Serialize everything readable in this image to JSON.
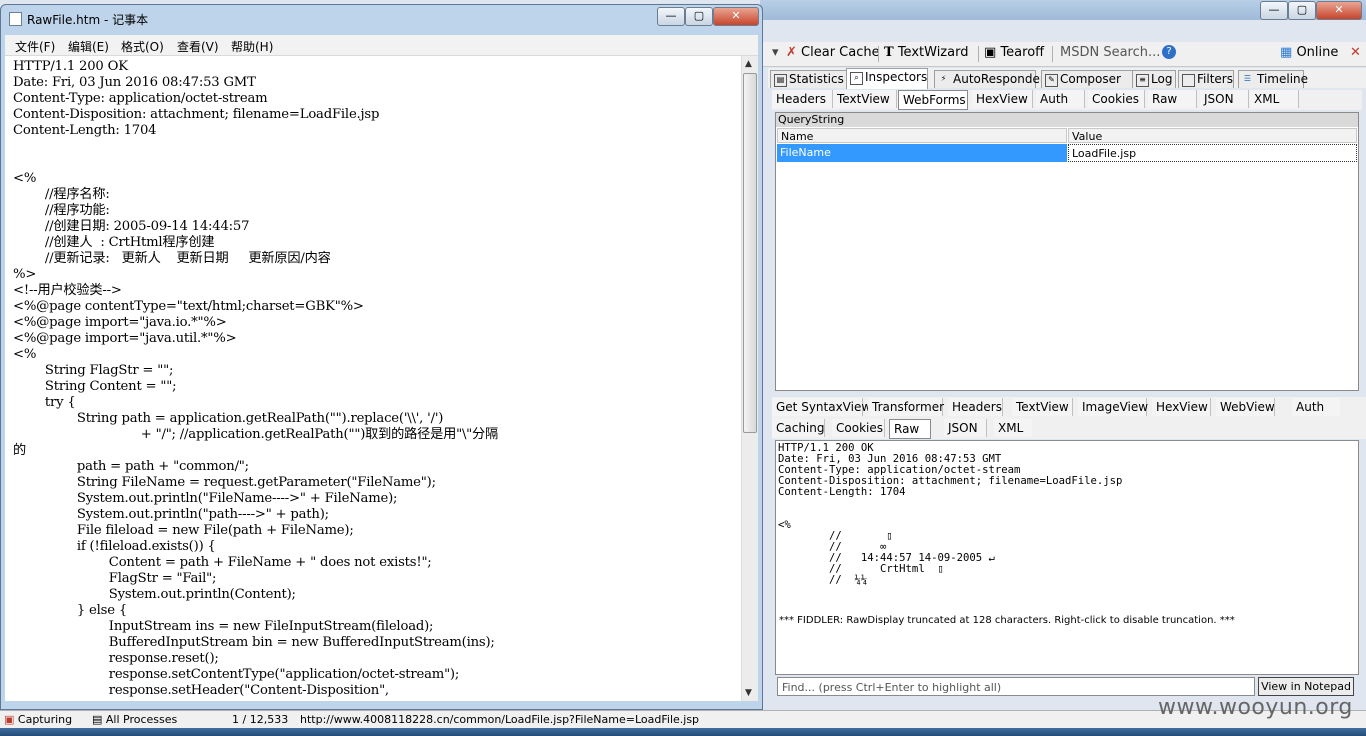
{
  "notepad": {
    "title": "RawFile.htm - 记事本",
    "menu": [
      "文件(F)",
      "编辑(E)",
      "格式(O)",
      "查看(V)",
      "帮助(H)"
    ],
    "window_buttons": [
      "—",
      "▢",
      "✕"
    ],
    "content": "HTTP/1.1 200 OK\nDate: Fri, 03 Jun 2016 08:47:53 GMT\nContent-Type: application/octet-stream\nContent-Disposition: attachment; filename=LoadFile.jsp\nContent-Length: 1704\n\n\n<%\n        //程序名称:\n        //程序功能:\n        //创建日期: 2005-09-14 14:44:57\n        //创建人  : CrtHtml程序创建\n        //更新记录:   更新人    更新日期     更新原因/内容\n%>\n<!--用户校验类-->\n<%@page contentType=\"text/html;charset=GBK\"%>\n<%@page import=\"java.io.*\"%>\n<%@page import=\"java.util.*\"%>\n<%\n        String FlagStr = \"\";\n        String Content = \"\";\n        try {\n                String path = application.getRealPath(\"\").replace('\\\\', '/')\n                                + \"/\"; //application.getRealPath(\"\")取到的路径是用\"\\\"分隔\n的\n                path = path + \"common/\";\n                String FileName = request.getParameter(\"FileName\");\n                System.out.println(\"FileName---->\" + FileName);\n                System.out.println(\"path---->\" + path);\n                File fileload = new File(path + FileName);\n                if (!fileload.exists()) {\n                        Content = path + FileName + \" does not exists!\";\n                        FlagStr = \"Fail\";\n                        System.out.println(Content);\n                } else {\n                        InputStream ins = new FileInputStream(fileload);\n                        BufferedInputStream bin = new BufferedInputStream(ins);\n                        response.reset();\n                        response.setContentType(\"application/octet-stream\");\n                        response.setHeader(\"Content-Disposition\","
  },
  "fiddler": {
    "window_buttons": [
      "—",
      "▢",
      "✕"
    ],
    "toolbar": {
      "clear_cache": "Clear Cache",
      "textwizard": "TextWizard",
      "tearoff": "Tearoff",
      "msdn_search": "MSDN Search...",
      "online": "Online"
    },
    "main_tabs": [
      "Statistics",
      "Inspectors",
      "AutoResponder",
      "Composer",
      "Log",
      "Filters",
      "Timeline"
    ],
    "request_tabs": [
      "Headers",
      "TextView",
      "WebForms",
      "HexView",
      "Auth",
      "Cookies",
      "Raw",
      "JSON",
      "XML"
    ],
    "querystring": {
      "label": "QueryString",
      "col_name": "Name",
      "col_value": "Value",
      "row_name": "FileName",
      "row_value": "LoadFile.jsp"
    },
    "response_tabs_row1": [
      "Get SyntaxView",
      "Transformer",
      "Headers",
      "TextView",
      "ImageView",
      "HexView",
      "WebView",
      "Auth"
    ],
    "response_tabs_row2": [
      "Caching",
      "Cookies",
      "Raw",
      "JSON",
      "XML"
    ],
    "response_raw": "HTTP/1.1 200 OK\nDate: Fri, 03 Jun 2016 08:47:53 GMT\nContent-Type: application/octet-stream\nContent-Disposition: attachment; filename=LoadFile.jsp\nContent-Length: 1704\n\n\n<%\n        //       ▯\n        //      ∞\n        //   14:44:57 14-09-2005 ↵\n        //      CrtHtml  ▯\n        //  ¼¼",
    "truncation_note": "*** FIDDLER: RawDisplay truncated at 128 characters. Right-click to disable truncation. ***",
    "find_placeholder": "Find... (press Ctrl+Enter to highlight all)",
    "view_in_notepad": "View in Notepad"
  },
  "statusbar": {
    "capturing": "Capturing",
    "processes": "All Processes",
    "count": "1 / 12,533",
    "url": "http://www.4008118228.cn/common/LoadFile.jsp?FileName=LoadFile.jsp"
  },
  "watermark": "www.wooyun.org",
  "colors": {
    "selection": "#3399ff",
    "titlebar": "#bed4ea",
    "close_button": "#c7452c"
  }
}
